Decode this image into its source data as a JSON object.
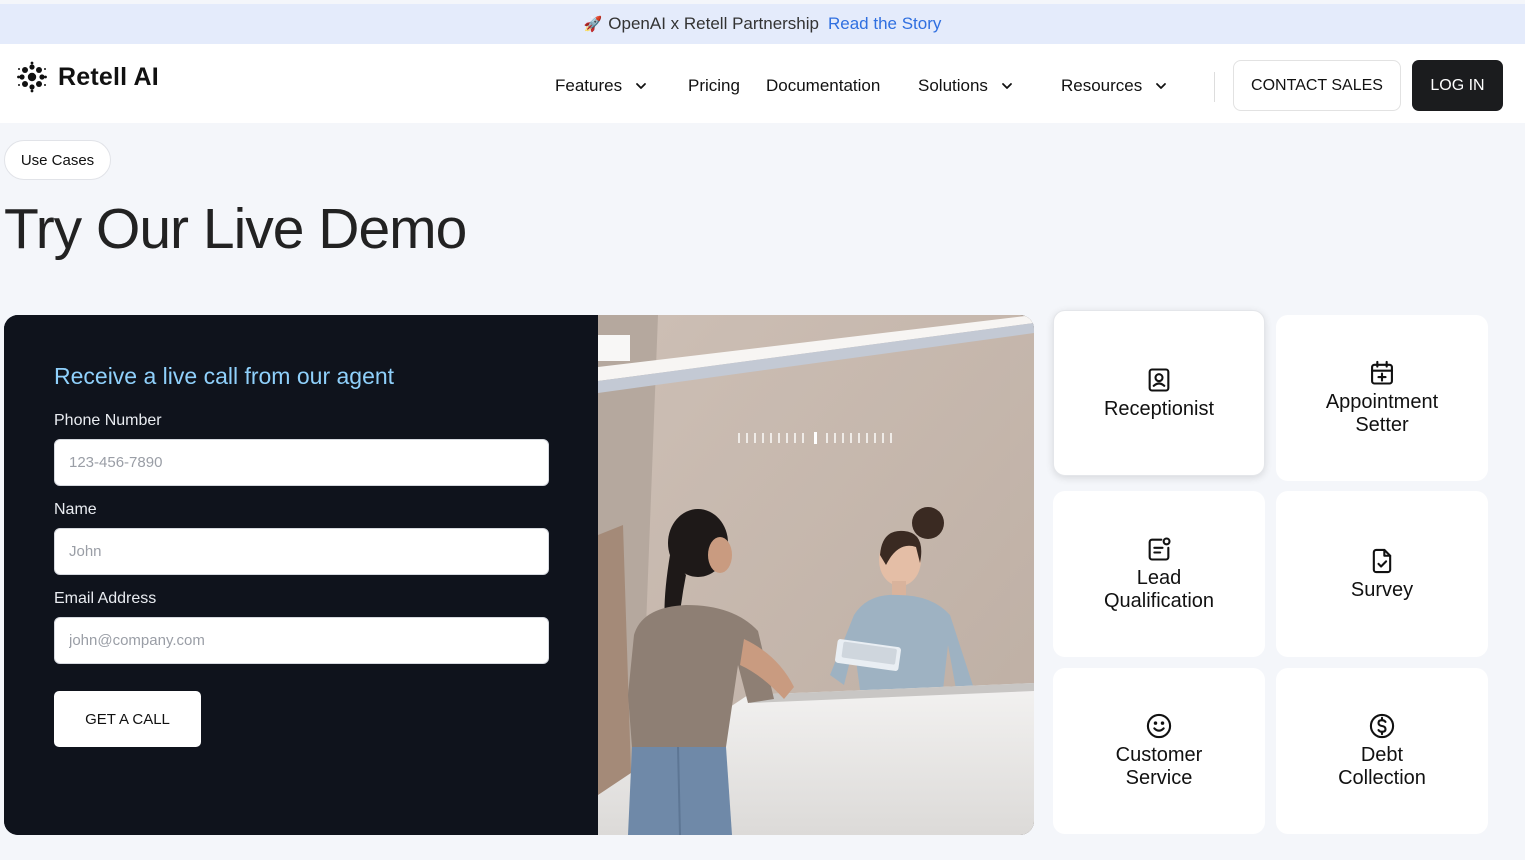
{
  "announcement": {
    "rocket": "🚀",
    "text": "OpenAI x Retell Partnership",
    "link": "Read the Story"
  },
  "nav": {
    "brand": "Retell AI",
    "items": [
      {
        "label": "Features",
        "dropdown": true
      },
      {
        "label": "Pricing",
        "dropdown": false
      },
      {
        "label": "Documentation",
        "dropdown": false
      },
      {
        "label": "Solutions",
        "dropdown": true
      },
      {
        "label": "Resources",
        "dropdown": true
      }
    ],
    "contact_label": "CONTACT SALES",
    "login_label": "LOG IN"
  },
  "hero": {
    "pill": "Use Cases",
    "title": "Try Our Live Demo"
  },
  "form": {
    "title": "Receive a live call from our agent",
    "phone_label": "Phone Number",
    "phone_placeholder": "123-456-7890",
    "name_label": "Name",
    "name_placeholder": "John",
    "email_label": "Email Address",
    "email_placeholder": "john@company.com",
    "submit_label": "GET A CALL"
  },
  "use_cases": [
    {
      "label": "Receptionist",
      "icon": "receptionist-icon",
      "selected": true
    },
    {
      "label": "Appointment\nSetter",
      "icon": "calendar-plus-icon",
      "selected": false
    },
    {
      "label": "Lead\nQualification",
      "icon": "lead-icon",
      "selected": false
    },
    {
      "label": "Survey",
      "icon": "file-check-icon",
      "selected": false
    },
    {
      "label": "Customer\nService",
      "icon": "smiley-icon",
      "selected": false
    },
    {
      "label": "Debt\nCollection",
      "icon": "dollar-circle-icon",
      "selected": false
    }
  ],
  "colors": {
    "announcement_bg": "#e4ebfb",
    "link": "#2f6fe0",
    "form_bg": "#0f131c",
    "form_title": "#8fd0fb",
    "page_bg": "#f4f6fa",
    "login_bg": "#1b1c1e"
  }
}
